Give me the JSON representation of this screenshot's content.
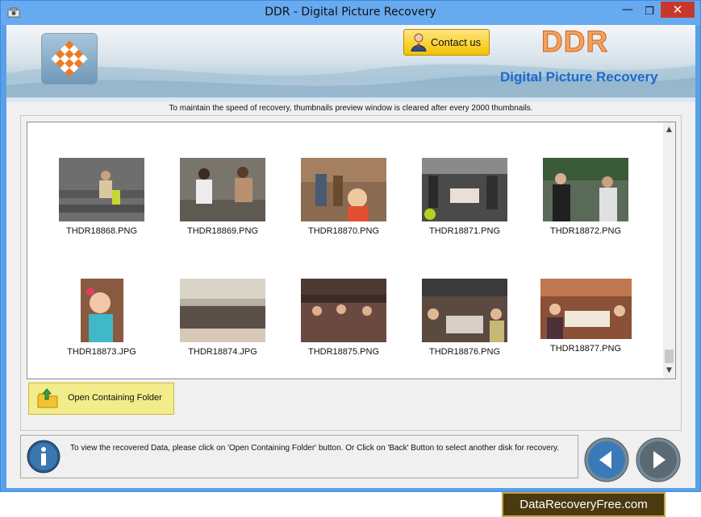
{
  "window": {
    "title": "DDR - Digital Picture Recovery",
    "min_glyph": "—",
    "max_glyph": "❐",
    "close_glyph": "✕",
    "icon": "app-icon"
  },
  "banner": {
    "contact_label": "Contact us",
    "brand": "DDR",
    "subtitle": "Digital Picture Recovery",
    "brand_color": "#f4a15a",
    "subtitle_color": "#1a6ad0"
  },
  "notice": "To maintain the speed of recovery, thumbnails preview window is cleared after every 2000 thumbnails.",
  "thumbnails": [
    {
      "label": "THDR18868.PNG"
    },
    {
      "label": "THDR18869.PNG"
    },
    {
      "label": "THDR18870.PNG"
    },
    {
      "label": "THDR18871.PNG"
    },
    {
      "label": "THDR18872.PNG"
    },
    {
      "label": "THDR18873.JPG"
    },
    {
      "label": "THDR18874.JPG"
    },
    {
      "label": "THDR18875.PNG"
    },
    {
      "label": "THDR18876.PNG"
    },
    {
      "label": "THDR18877.PNG"
    }
  ],
  "scrollbar": {
    "up_glyph": "▲",
    "down_glyph": "▼"
  },
  "actions": {
    "open_folder_label": "Open Containing Folder"
  },
  "status": {
    "text": "To view the recovered Data, please click on 'Open Containing Folder' button. Or Click on 'Back' Button to select another disk for recovery."
  },
  "footer": {
    "badge": "DataRecoveryFree.com"
  }
}
